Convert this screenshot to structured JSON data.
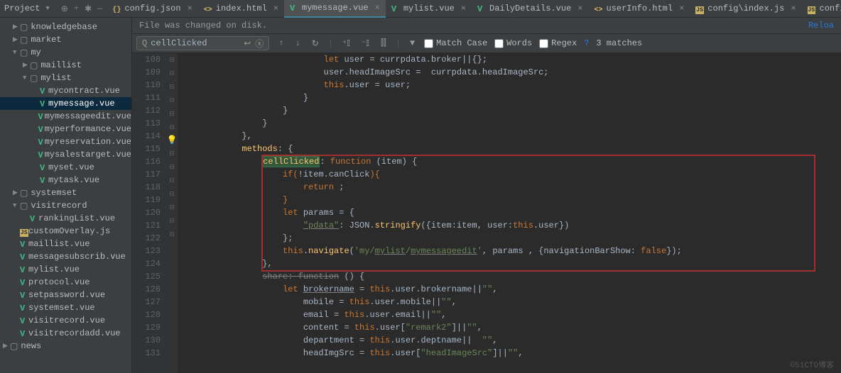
{
  "header": {
    "project_label": "Project"
  },
  "tabs": [
    {
      "icon": "json",
      "label": "config.json",
      "close": true
    },
    {
      "icon": "html",
      "label": "index.html",
      "close": true
    },
    {
      "icon": "vue",
      "label": "mymessage.vue",
      "close": true,
      "active": true
    },
    {
      "icon": "vue",
      "label": "mylist.vue",
      "close": true
    },
    {
      "icon": "vue",
      "label": "DailyDetails.vue",
      "close": true
    },
    {
      "icon": "html",
      "label": "userInfo.html",
      "close": true
    },
    {
      "icon": "js",
      "label": "config\\index.js",
      "close": true
    },
    {
      "icon": "js",
      "label": "config.js",
      "close": true
    }
  ],
  "tree": [
    {
      "indent": 1,
      "tri": "▶",
      "icon": "fold",
      "label": "knowledgebase"
    },
    {
      "indent": 1,
      "tri": "▶",
      "icon": "fold",
      "label": "market"
    },
    {
      "indent": 1,
      "tri": "▼",
      "icon": "fold",
      "label": "my"
    },
    {
      "indent": 2,
      "tri": "▶",
      "icon": "fold",
      "label": "maillist"
    },
    {
      "indent": 2,
      "tri": "▼",
      "icon": "fold",
      "label": "mylist"
    },
    {
      "indent": 3,
      "tri": "",
      "icon": "vue",
      "label": "mycontract.vue"
    },
    {
      "indent": 3,
      "tri": "",
      "icon": "vue",
      "label": "mymessage.vue",
      "sel": true
    },
    {
      "indent": 3,
      "tri": "",
      "icon": "vue",
      "label": "mymessageedit.vue"
    },
    {
      "indent": 3,
      "tri": "",
      "icon": "vue",
      "label": "myperformance.vue"
    },
    {
      "indent": 3,
      "tri": "",
      "icon": "vue",
      "label": "myreservation.vue"
    },
    {
      "indent": 3,
      "tri": "",
      "icon": "vue",
      "label": "mysalestarget.vue"
    },
    {
      "indent": 3,
      "tri": "",
      "icon": "vue",
      "label": "myset.vue"
    },
    {
      "indent": 3,
      "tri": "",
      "icon": "vue",
      "label": "mytask.vue"
    },
    {
      "indent": 1,
      "tri": "▶",
      "icon": "fold",
      "label": "systemset"
    },
    {
      "indent": 1,
      "tri": "▼",
      "icon": "fold",
      "label": "visitrecord"
    },
    {
      "indent": 2,
      "tri": "",
      "icon": "vue",
      "label": "rankingList.vue"
    },
    {
      "indent": 1,
      "tri": "",
      "icon": "js",
      "label": "customOverlay.js"
    },
    {
      "indent": 1,
      "tri": "",
      "icon": "vue",
      "label": "maillist.vue"
    },
    {
      "indent": 1,
      "tri": "",
      "icon": "vue",
      "label": "messagesubscrib.vue"
    },
    {
      "indent": 1,
      "tri": "",
      "icon": "vue",
      "label": "mylist.vue"
    },
    {
      "indent": 1,
      "tri": "",
      "icon": "vue",
      "label": "protocol.vue"
    },
    {
      "indent": 1,
      "tri": "",
      "icon": "vue",
      "label": "setpassword.vue"
    },
    {
      "indent": 1,
      "tri": "",
      "icon": "vue",
      "label": "systemset.vue"
    },
    {
      "indent": 1,
      "tri": "",
      "icon": "vue",
      "label": "visitrecord.vue"
    },
    {
      "indent": 1,
      "tri": "",
      "icon": "vue",
      "label": "visitrecordadd.vue"
    },
    {
      "indent": 0,
      "tri": "▶",
      "icon": "fold",
      "label": "news"
    }
  ],
  "notice": {
    "text": "File was changed on disk.",
    "reload": "Reloa"
  },
  "find": {
    "value": "cellClicked",
    "match_case": "Match Case",
    "words": "Words",
    "regex": "Regex",
    "matches": "3 matches"
  },
  "gutter": [
    "108",
    "109",
    "110",
    "111",
    "112",
    "113",
    "114",
    "115",
    "116",
    "117",
    "118",
    "119",
    "120",
    "121",
    "122",
    "123",
    "124",
    "125",
    "126",
    "127",
    "128",
    "129",
    "130",
    "131"
  ],
  "code": {
    "l108a": "let",
    "l108b": " user = currpdata.broker||{};",
    "l109": "user.headImageSrc =  currpdata.headImageSrc;",
    "l110a": "this",
    "l110b": ".user = user;",
    "l111": "}",
    "l112": "}",
    "l113": "}",
    "l114": "},",
    "l115a": "methods",
    "l115b": ": {",
    "l116a": "cellClicked",
    "l116b": ": ",
    "l116c": "function",
    "l116d": " (item) {",
    "l117a": "if(",
    "l117b": "!item.canClick",
    "l117c": "){",
    "l118a": "return",
    "l118b": " ;",
    "l119": "}",
    "l120a": "let",
    "l120b": " params = {",
    "l121a": "\"pdata\"",
    "l121b": ": JSON.",
    "l121c": "stringify",
    "l121d": "({item:item, user:",
    "l121e": "this",
    "l121f": ".user})",
    "l122": "};",
    "l123a": "this",
    "l123b": ".",
    "l123c": "navigate",
    "l123d": "(",
    "l123e": "'my/",
    "l123f": "mylist",
    "l123g": "/",
    "l123h": "mymessageedit",
    "l123i": "'",
    "l123j": ", params , {navigationBarShow: ",
    "l123k": "false",
    "l123l": "});",
    "l124": "},",
    "l125a": "share: function",
    "l125b": " () {",
    "l126a": "let",
    "l126b": " ",
    "l126c": "brokername",
    "l126d": " = ",
    "l126e": "this",
    "l126f": ".user.brokername||",
    "l126g": "\"\"",
    "l126h": ",",
    "l127a": "mobile = ",
    "l127b": "this",
    "l127c": ".user.mobile||",
    "l127d": "\"\"",
    "l127e": ",",
    "l128a": "email = ",
    "l128b": "this",
    "l128c": ".user.email||",
    "l128d": "\"\"",
    "l128e": ",",
    "l129a": "content = ",
    "l129b": "this",
    "l129c": ".user[",
    "l129d": "\"remark2\"",
    "l129e": "]||",
    "l129f": "\"\"",
    "l129g": ",",
    "l130a": "department = ",
    "l130b": "this",
    "l130c": ".user.deptname||  ",
    "l130d": "\"\"",
    "l130e": ",",
    "l131a": "headImgSrc = ",
    "l131b": "this",
    "l131c": ".user[",
    "l131d": "\"headImageSrc\"",
    "l131e": "]||",
    "l131f": "\"\"",
    "l131g": ","
  },
  "watermark": "©51CTO博客"
}
